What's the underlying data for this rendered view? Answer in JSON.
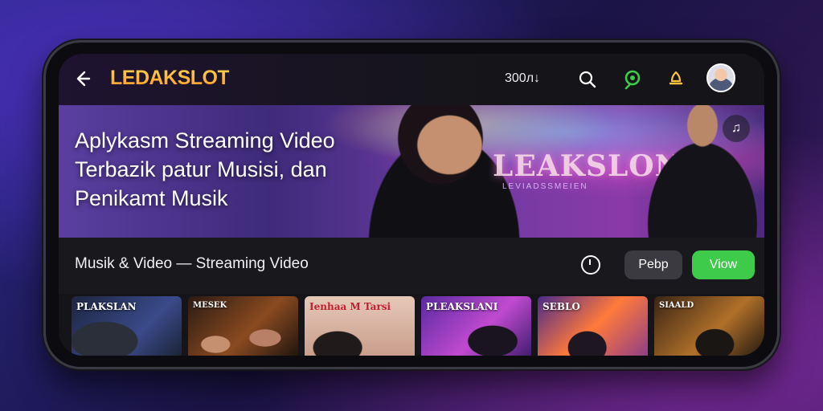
{
  "app": {
    "brand": "LEDAKSLOT",
    "balance": "300л↓"
  },
  "topbar": {
    "icons": [
      "back-arrow-icon",
      "search-icon",
      "location-pin-icon",
      "bell-icon",
      "avatar"
    ]
  },
  "hero": {
    "title": "Aplykasm Streaming Video Terbazik patur Musisi, dan Penikamt Musik",
    "logo_text": "LEAKSLON",
    "logo_sub": "LEVIADSSMEIEN"
  },
  "section": {
    "title": "Musik & Video — Streaming Video",
    "pill_dark": "Pebp",
    "pill_green": "Viow"
  },
  "thumbnails": [
    {
      "caption": "PLAKSLAN"
    },
    {
      "caption": "MESEK"
    },
    {
      "caption": "Ienhaa M Tarsi"
    },
    {
      "caption": "PLEAKSLANI"
    },
    {
      "caption": "SEBLO"
    },
    {
      "caption": "SIAALD"
    }
  ],
  "colors": {
    "accent_green": "#3ecb4a",
    "brand_gold": "#ffc23a"
  }
}
